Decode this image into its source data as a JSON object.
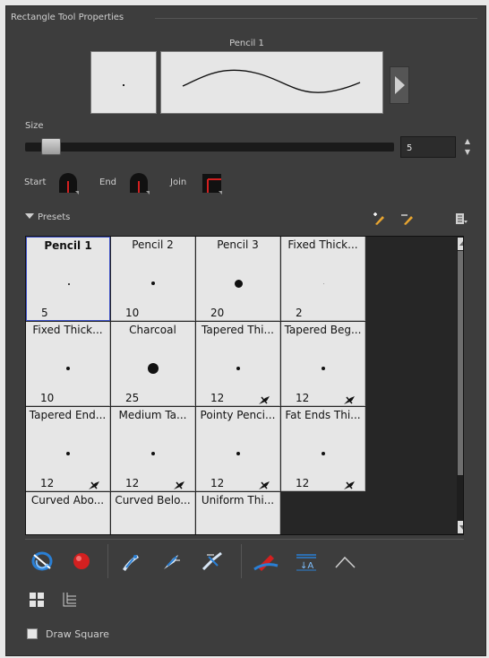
{
  "panel": {
    "title": "Rectangle Tool Properties"
  },
  "brush_preview": {
    "name": "Pencil 1"
  },
  "size": {
    "label": "Size",
    "value": "5",
    "slider_fraction": 0.02
  },
  "caps": {
    "start_label": "Start",
    "end_label": "End",
    "join_label": "Join"
  },
  "presets": {
    "label": "Presets",
    "items": [
      {
        "name": "Pencil 1",
        "size": "5",
        "selected": true,
        "tapered": false
      },
      {
        "name": "Pencil 2",
        "size": "10",
        "selected": false,
        "tapered": false
      },
      {
        "name": "Pencil 3",
        "size": "20",
        "selected": false,
        "tapered": false
      },
      {
        "name": "Fixed Thick...",
        "size": "2",
        "selected": false,
        "tapered": false
      },
      {
        "name": "Fixed Thick...",
        "size": "10",
        "selected": false,
        "tapered": false
      },
      {
        "name": "Charcoal",
        "size": "25",
        "selected": false,
        "tapered": false
      },
      {
        "name": "Tapered Thi...",
        "size": "12",
        "selected": false,
        "tapered": true
      },
      {
        "name": "Tapered Beg...",
        "size": "12",
        "selected": false,
        "tapered": true
      },
      {
        "name": "Tapered End...",
        "size": "12",
        "selected": false,
        "tapered": true
      },
      {
        "name": "Medium Ta...",
        "size": "12",
        "selected": false,
        "tapered": true
      },
      {
        "name": "Pointy Penci...",
        "size": "12",
        "selected": false,
        "tapered": true
      },
      {
        "name": "Fat Ends Thi...",
        "size": "12",
        "selected": false,
        "tapered": true
      },
      {
        "name": "Curved Abo...",
        "size": "",
        "selected": false,
        "tapered": false
      },
      {
        "name": "Curved Belo...",
        "size": "",
        "selected": false,
        "tapered": false
      },
      {
        "name": "Uniform Thi...",
        "size": "",
        "selected": false,
        "tapered": false
      }
    ]
  },
  "options": {
    "draw_square_label": "Draw Square",
    "draw_square_checked": false
  },
  "colors": {
    "panel_bg": "#3d3d3d",
    "accent_red": "#d32020",
    "accent_blue": "#2a7fd4",
    "selection": "#3b4fc4"
  }
}
